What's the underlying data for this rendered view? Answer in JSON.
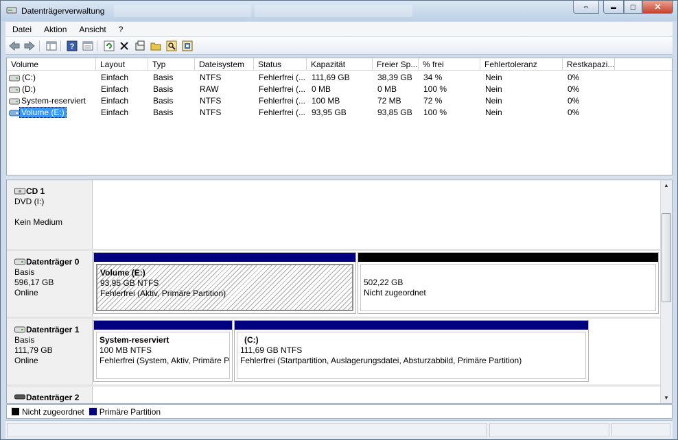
{
  "window": {
    "title": "Datenträgerverwaltung",
    "controls": {
      "restore": "⇔",
      "minimize": "▬",
      "maximize": "□",
      "close": "✕"
    }
  },
  "menu": [
    "Datei",
    "Aktion",
    "Ansicht",
    "?"
  ],
  "toolbar": [
    "back-icon",
    "forward-icon",
    "console-tree-icon",
    "help-icon",
    "properties-view-icon",
    "refresh-icon",
    "delete-icon",
    "properties-icon",
    "open-folder-icon",
    "search-icon",
    "settings-icon"
  ],
  "volume_list": {
    "columns": [
      "Volume",
      "Layout",
      "Typ",
      "Dateisystem",
      "Status",
      "Kapazität",
      "Freier Sp...",
      "% frei",
      "Fehlertoleranz",
      "Restkapazi..."
    ],
    "rows": [
      {
        "volume": "(C:)",
        "layout": "Einfach",
        "typ": "Basis",
        "fs": "NTFS",
        "status": "Fehlerfrei (...",
        "capacity": "111,69 GB",
        "free": "38,39 GB",
        "pct": "34 %",
        "fault": "Nein",
        "overhead": "0%"
      },
      {
        "volume": "(D:)",
        "layout": "Einfach",
        "typ": "Basis",
        "fs": "RAW",
        "status": "Fehlerfrei (...",
        "capacity": "0 MB",
        "free": "0 MB",
        "pct": "100 %",
        "fault": "Nein",
        "overhead": "0%"
      },
      {
        "volume": "System-reserviert",
        "layout": "Einfach",
        "typ": "Basis",
        "fs": "NTFS",
        "status": "Fehlerfrei (...",
        "capacity": "100 MB",
        "free": "72 MB",
        "pct": "72 %",
        "fault": "Nein",
        "overhead": "0%"
      },
      {
        "volume": "Volume (E:)",
        "layout": "Einfach",
        "typ": "Basis",
        "fs": "NTFS",
        "status": "Fehlerfrei (...",
        "capacity": "93,95 GB",
        "free": "93,85 GB",
        "pct": "100 %",
        "fault": "Nein",
        "overhead": "0%"
      }
    ]
  },
  "disks": [
    {
      "name": "CD 1",
      "line2": "DVD (I:)",
      "line3": "",
      "line4": "Kein Medium"
    },
    {
      "name": "Datenträger 0",
      "line2": "Basis",
      "line3": "596,17 GB",
      "line4": "Online",
      "partitions": [
        {
          "title": "Volume  (E:)",
          "size": "93,95 GB NTFS",
          "status": "Fehlerfrei (Aktiv, Primäre Partition)"
        },
        {
          "title": "",
          "size": "502,22 GB",
          "status": "Nicht zugeordnet"
        }
      ]
    },
    {
      "name": "Datenträger 1",
      "line2": "Basis",
      "line3": "111,79 GB",
      "line4": "Online",
      "partitions": [
        {
          "title": "System-reserviert",
          "size": "100 MB NTFS",
          "status": "Fehlerfrei (System, Aktiv, Primäre Pa"
        },
        {
          "title": "(C:)",
          "size": "111,69 GB NTFS",
          "status": "Fehlerfrei (Startpartition, Auslagerungsdatei, Absturzabbild, Primäre Partition)"
        }
      ]
    },
    {
      "name": "Datenträger 2"
    }
  ],
  "legend": [
    {
      "label": "Nicht zugeordnet",
      "color": "#000000"
    },
    {
      "label": "Primäre Partition",
      "color": "#000080"
    }
  ],
  "colors": {
    "primary_partition": "#000080",
    "unallocated": "#000000",
    "selection": "#3399ff"
  }
}
